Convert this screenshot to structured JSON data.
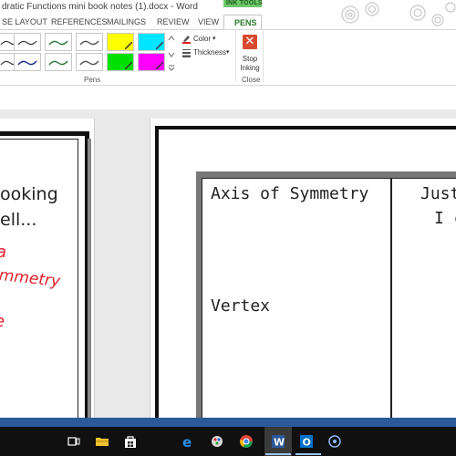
{
  "window": {
    "title": "dratic Functions mini book notes (1).docx - Word"
  },
  "ribbon": {
    "contextual_group": "INK TOOLS",
    "tabs": [
      {
        "label": "SE LAYOUT"
      },
      {
        "label": "REFERENCES"
      },
      {
        "label": "MAILINGS"
      },
      {
        "label": "REVIEW"
      },
      {
        "label": "VIEW"
      }
    ],
    "active_tab": "PENS",
    "color_label": "Color",
    "thickness_label": "Thickness",
    "pens_group_label": "Pens",
    "stop_inking_label_line1": "Stop",
    "stop_inking_label_line2": "Inking",
    "close_group_label": "Close",
    "pen_colors_row1": [
      "#3a3a3a",
      "#2a7a3a",
      "#3a8aa0",
      "#555555",
      "#ffff00",
      "#00e5ff"
    ],
    "pen_colors_row2": [
      "#3a3a3a",
      "#1a2a8a",
      "#2a7a3a",
      "#555555",
      "#00e000",
      "#ff00ff"
    ],
    "accent_color": "#2b7a28"
  },
  "document": {
    "left_page_lines": [
      "ooking",
      "ell..."
    ],
    "left_page_ink": [
      "a",
      "mmetry",
      "e"
    ],
    "ink_color": "#e0202a",
    "table": {
      "cell1_title": "Axis of Symmetry",
      "cell1_sub": "Vertex",
      "cell2_line1": "Just",
      "cell2_line2": "I c"
    }
  },
  "taskbar": {
    "icons": [
      "task-view-icon",
      "file-explorer-icon",
      "store-icon",
      "edge-icon",
      "paint-icon",
      "chrome-icon",
      "word-icon",
      "outlook-icon",
      "cortana-icon"
    ]
  }
}
